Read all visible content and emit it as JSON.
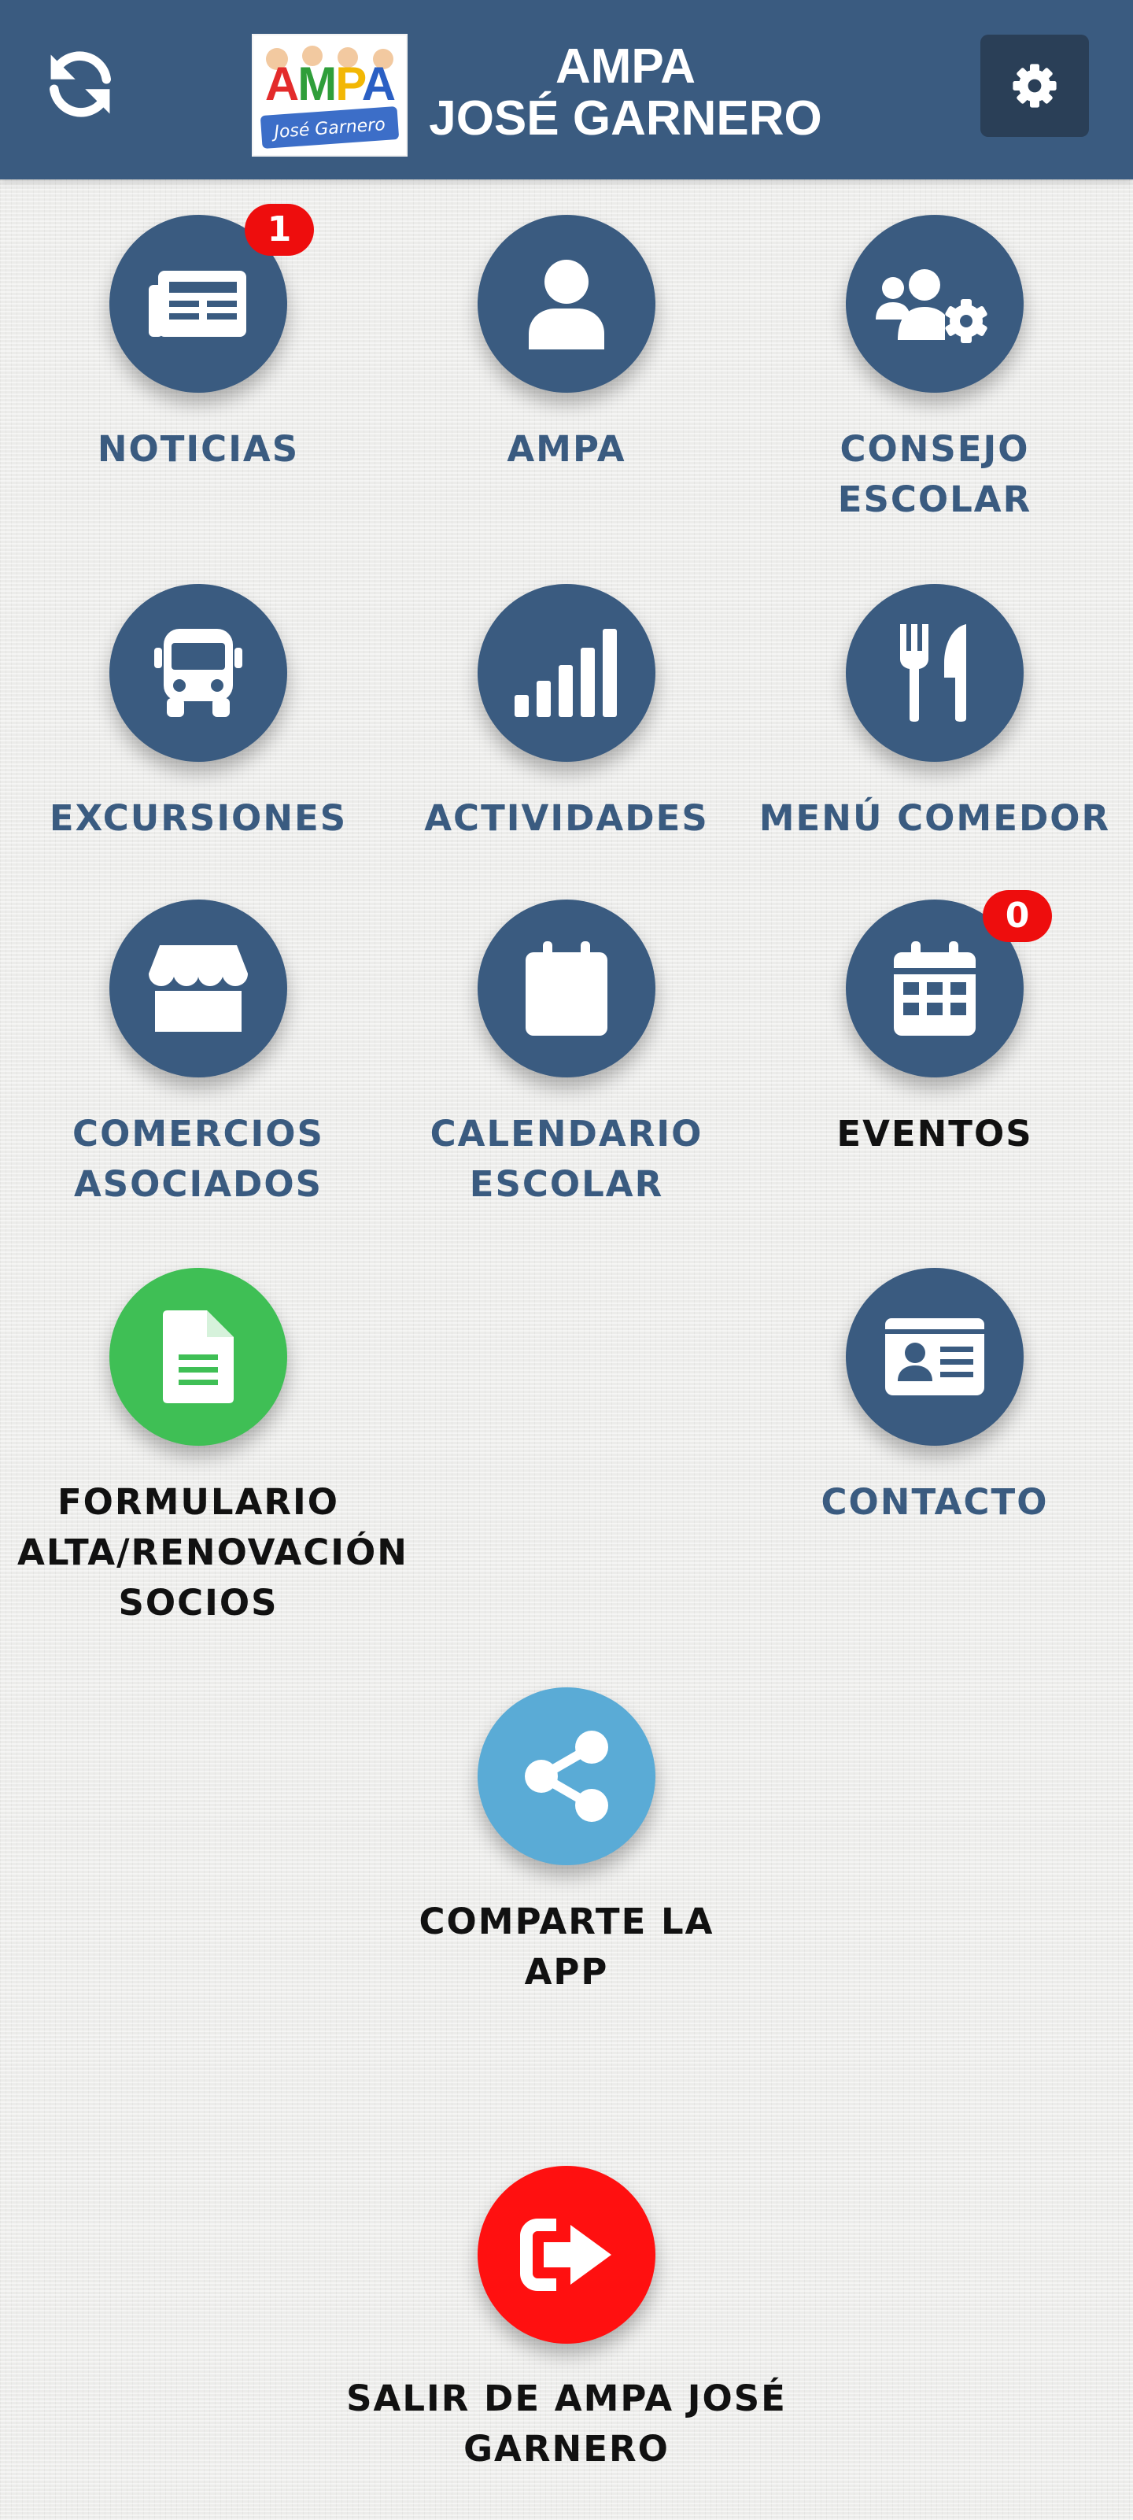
{
  "header": {
    "title_line1": "AMPA",
    "title_line2": "JOSÉ GARNERO",
    "logo_text": "AMPA",
    "logo_subtext": "José Garnero",
    "icons": {
      "refresh": "refresh-icon",
      "settings": "gear-icon"
    }
  },
  "tiles": {
    "noticias": {
      "label": "NOTICIAS",
      "badge": "1",
      "icon": "newspaper-icon"
    },
    "ampa": {
      "label": "AMPA",
      "icon": "user-icon"
    },
    "consejo": {
      "label": "CONSEJO\nESCOLAR",
      "icon": "users-cog-icon"
    },
    "excursiones": {
      "label": "EXCURSIONES",
      "icon": "bus-icon"
    },
    "actividades": {
      "label": "ACTIVIDADES",
      "icon": "signal-bars-icon"
    },
    "menu": {
      "label": "MENÚ COMEDOR",
      "icon": "utensils-icon"
    },
    "comercios": {
      "label": "COMERCIOS\nASOCIADOS",
      "icon": "store-icon"
    },
    "calendario": {
      "label": "CALENDARIO\nESCOLAR",
      "icon": "calendar-icon"
    },
    "eventos": {
      "label": "EVENTOS",
      "badge": "0",
      "icon": "calendar-grid-icon"
    },
    "formulario": {
      "label": "FORMULARIO\nALTA/RENOVACIÓN\nSOCIOS",
      "icon": "document-icon"
    },
    "contacto": {
      "label": "CONTACTO",
      "icon": "id-card-icon"
    },
    "compartir": {
      "label": "COMPARTE LA\nAPP",
      "icon": "share-icon"
    },
    "salir": {
      "label": "SALIR DE AMPA JOSÉ GARNERO",
      "icon": "sign-out-icon"
    }
  },
  "colors": {
    "header": "#3a5b80",
    "settings_button": "#2a3f57",
    "tile_primary": "#3a5b80",
    "tile_form": "#3fbf55",
    "tile_share": "#5aabd6",
    "tile_exit": "#ff1010",
    "badge": "#ee0d0d"
  }
}
